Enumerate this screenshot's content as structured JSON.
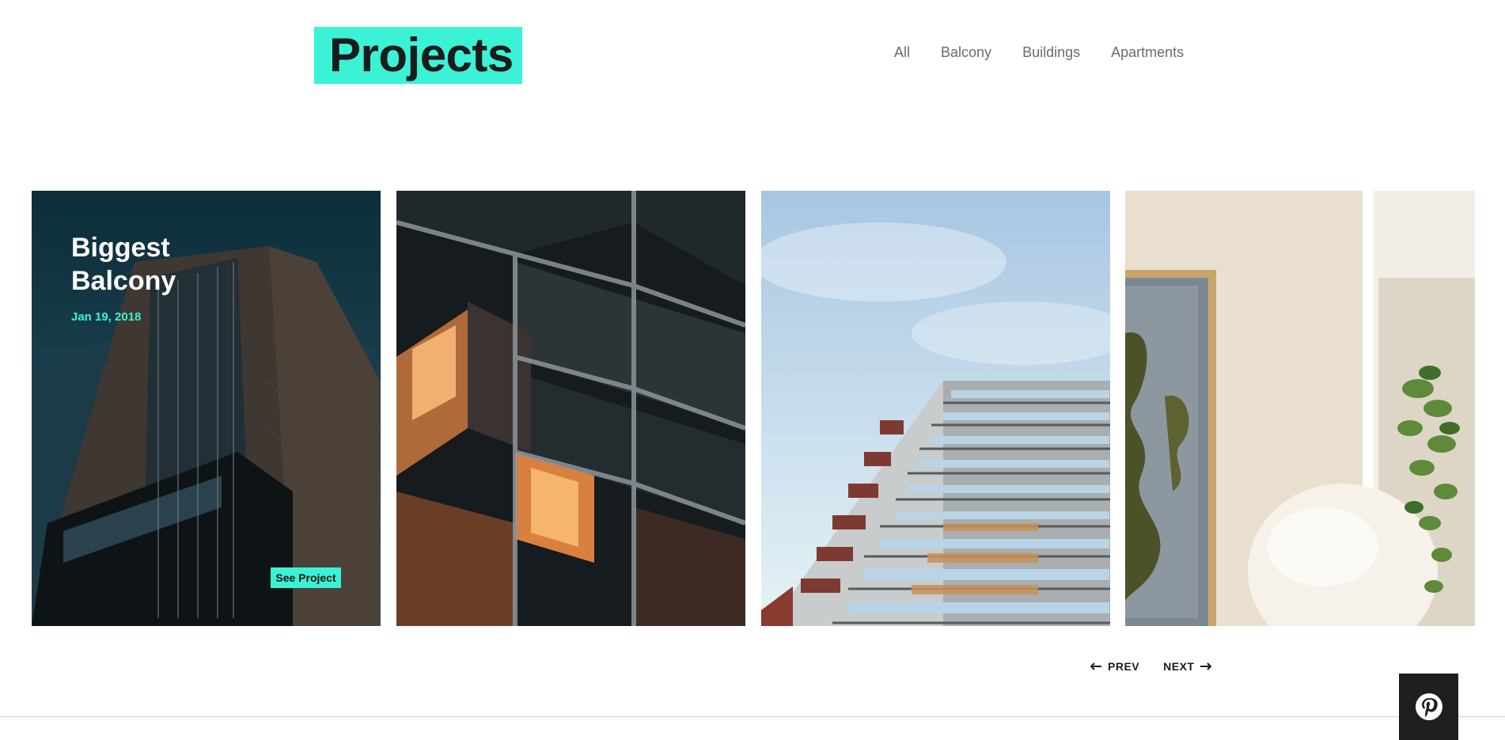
{
  "header": {
    "title": "Projects"
  },
  "filters": [
    "All",
    "Balcony",
    "Buildings",
    "Apartments"
  ],
  "featured": {
    "title": "Biggest Balcony",
    "date": "Jan 19, 2018",
    "button": "See Project"
  },
  "pager": {
    "prev": "PREV",
    "next": "NEXT"
  },
  "colors": {
    "accent": "#3cf2d6",
    "text_dark": "#1b1b1b",
    "nav_text": "#6b6b6b"
  },
  "icons": [
    "arrow-left-icon",
    "arrow-right-icon",
    "pinterest-icon"
  ]
}
